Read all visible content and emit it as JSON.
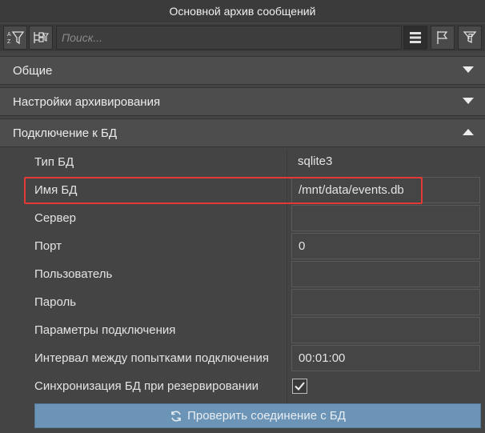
{
  "window": {
    "title": "Основной архив сообщений"
  },
  "toolbar": {
    "search_placeholder": "Поиск...",
    "icons": [
      "sort-az-filter-icon",
      "tree-filter-icon",
      "list-view-icon",
      "flag-icon",
      "flag-filter-icon"
    ]
  },
  "sections": [
    {
      "label": "Общие",
      "state": "collapsed"
    },
    {
      "label": "Настройки архивирования",
      "state": "collapsed"
    },
    {
      "label": "Подключение к БД",
      "state": "expanded"
    }
  ],
  "db": {
    "rows": [
      {
        "label": "Тип БД",
        "value": "sqlite3"
      },
      {
        "label": "Имя БД",
        "value": "/mnt/data/events.db"
      },
      {
        "label": "Сервер",
        "value": ""
      },
      {
        "label": "Порт",
        "value": "0"
      },
      {
        "label": "Пользователь",
        "value": ""
      },
      {
        "label": "Пароль",
        "value": ""
      },
      {
        "label": "Параметры подключения",
        "value": ""
      },
      {
        "label": "Интервал между попытками подключения",
        "value": "00:01:00"
      },
      {
        "label": "Синхронизация БД при резервировании",
        "checked": true
      }
    ],
    "check_button": "Проверить соединение с БД"
  },
  "colors": {
    "highlight": "#e53935",
    "button": "#6b94b6",
    "background": "#444444"
  }
}
